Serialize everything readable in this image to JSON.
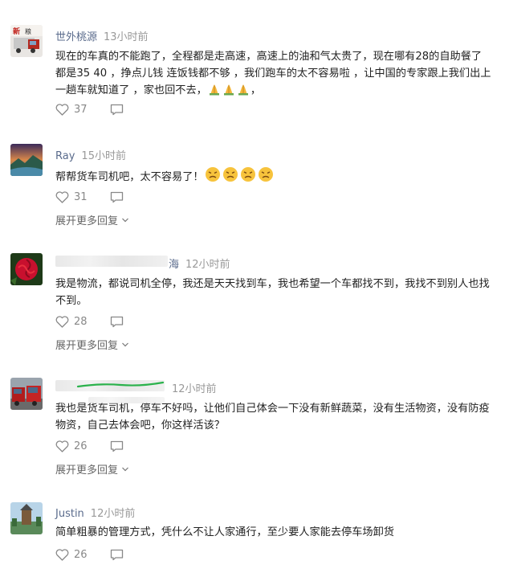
{
  "comments": [
    {
      "name": "世外桃源",
      "time": "13小时前",
      "text": "现在的车真的不能跑了，全程都是走高速，高速上的油和气太贵了，现在哪有28的自助餐了 都是35 40 ，挣点儿钱 连饭钱都不够 ，我们跑车的太不容易啦 ，让中国的专家跟上我们出上一趟车就知道了 ，家也回不去，",
      "emojis": [
        "pray-emoji",
        "pray-emoji",
        "pray-emoji"
      ],
      "text_after": "，",
      "likes": "37"
    },
    {
      "name": "Ray",
      "time": "15小时前",
      "text": "帮帮货车司机吧，太不容易了！",
      "emojis": [
        "angry-emoji",
        "angry-emoji",
        "angry-emoji",
        "angry-emoji"
      ],
      "text_after": "",
      "likes": "31",
      "more": "展开更多回复"
    },
    {
      "name": "海",
      "time": "12小时前",
      "text": "我是物流，都说司机全停，我还是天天找到车，我也希望一个车都找不到，我找不到别人也找不到。",
      "likes": "28",
      "more": "展开更多回复"
    },
    {
      "name": "",
      "time": "12小时前",
      "text": "我也是货车司机，停车不好吗，让他们自己体会一下没有新鲜蔬菜，没有生活物资，没有防疫物资，自己去体会吧，你这样活该？",
      "likes": "26",
      "more": "展开更多回复"
    },
    {
      "name": "Justin",
      "time": "12小时前",
      "text": "简单粗暴的管理方式，凭什么不让人家通行，至少要人家能去停车场卸货",
      "likes": "26"
    }
  ],
  "icons": {
    "like": "heart-outline-icon",
    "reply": "speech-bubble-icon",
    "expand": "chevron-down-icon"
  },
  "colors": {
    "name": "#5a6b8c",
    "time": "#999999",
    "text": "#222222",
    "redaction_stroke": "#2bb24c"
  }
}
